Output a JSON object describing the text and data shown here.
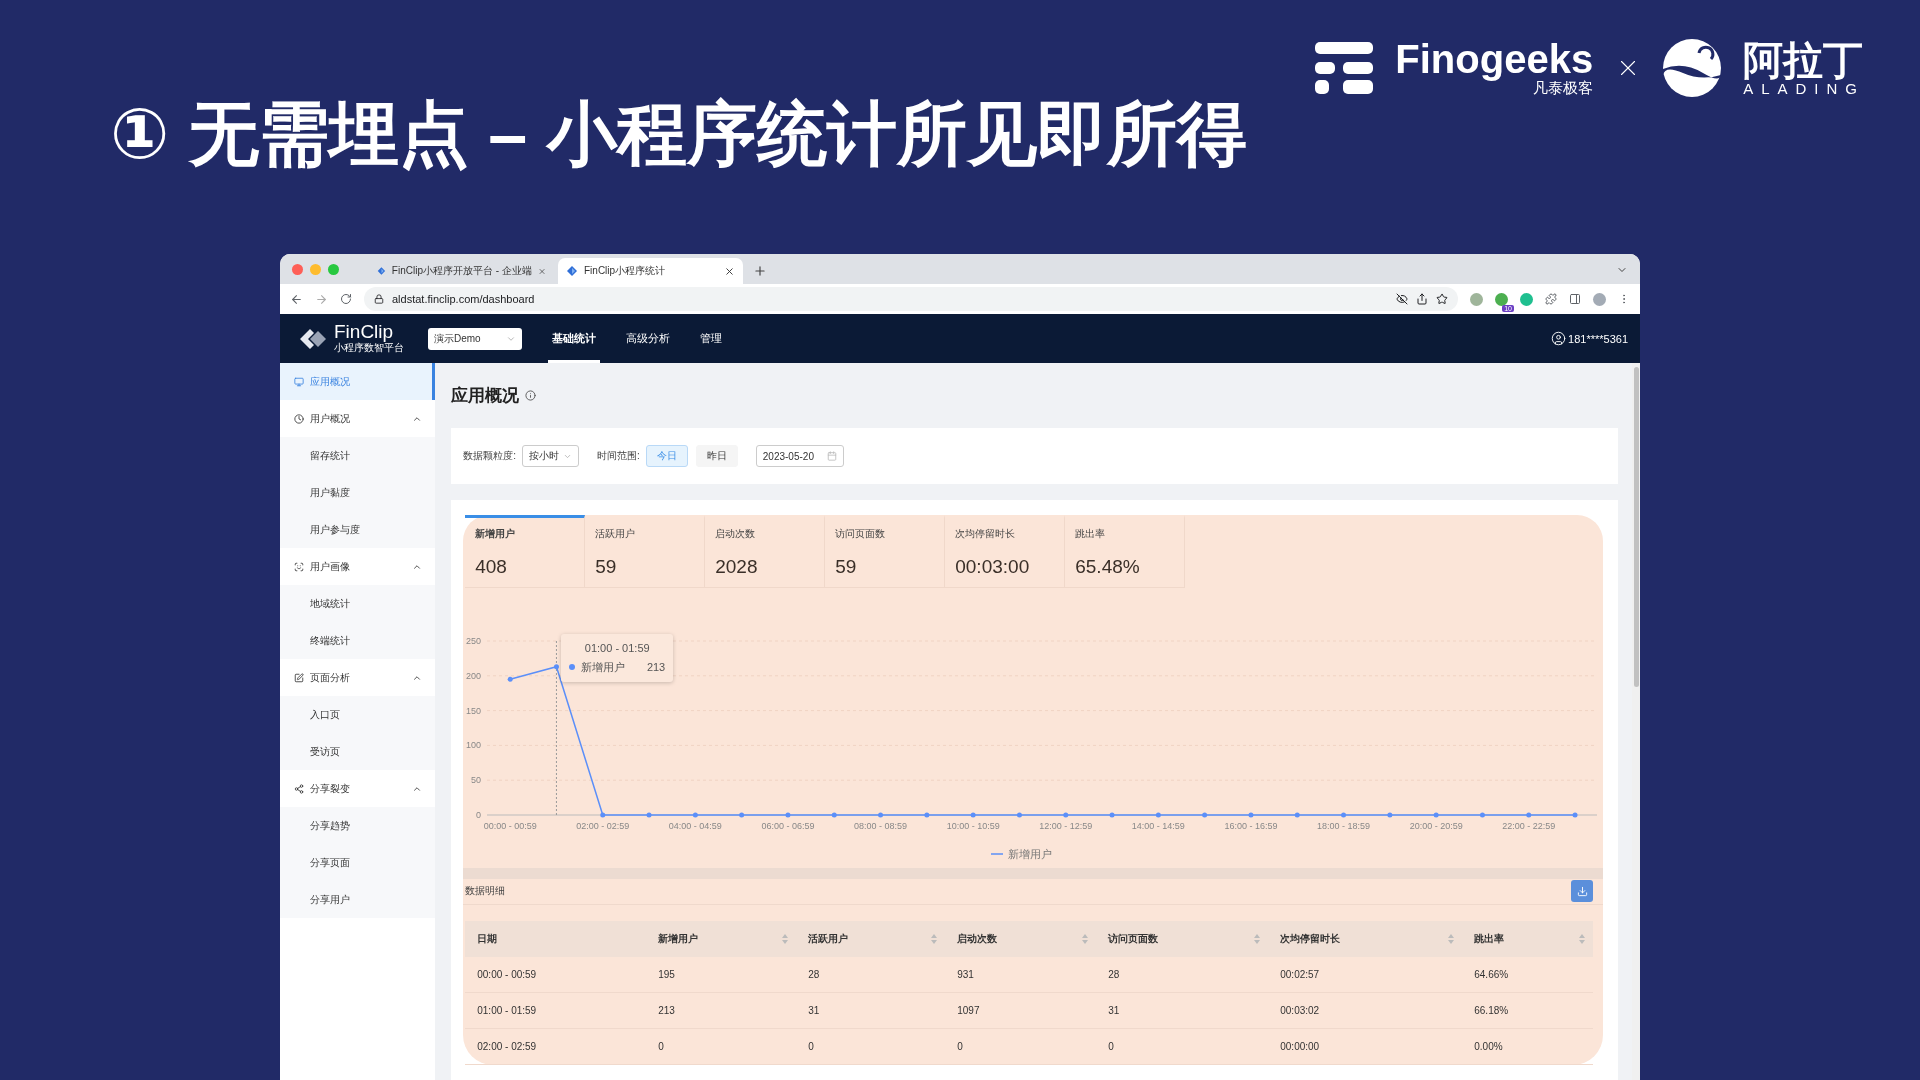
{
  "slide": {
    "title": "① 无需埋点 – 小程序统计所见即所得",
    "brand_a": "Finogeeks",
    "brand_a_sub": "凡泰极客",
    "brand_b": "阿拉丁",
    "brand_b_sub": "ALADING"
  },
  "browser": {
    "tabs": [
      {
        "title": "FinClip小程序开放平台 - 企业端",
        "selected": false
      },
      {
        "title": "FinClip小程序统计",
        "selected": true
      }
    ],
    "url": "aldstat.finclip.com/dashboard",
    "extension_badge": "10"
  },
  "app": {
    "logo": "FinClip",
    "logo_subtitle": "小程序数智平台",
    "app_select": "演示Demo",
    "nav": [
      {
        "label": "基础统计",
        "selected": true
      },
      {
        "label": "高级分析",
        "selected": false
      },
      {
        "label": "管理",
        "selected": false
      }
    ],
    "user": "181****5361"
  },
  "sidebar": [
    {
      "label": "应用概况",
      "selected": true
    },
    {
      "label": "用户概况",
      "selected": false,
      "expanded": true,
      "children": [
        {
          "label": "留存统计",
          "selected": false
        },
        {
          "label": "用户黏度",
          "selected": false
        },
        {
          "label": "用户参与度",
          "selected": false
        }
      ]
    },
    {
      "label": "用户画像",
      "selected": false,
      "expanded": true,
      "children": [
        {
          "label": "地域统计",
          "selected": false
        },
        {
          "label": "终端统计",
          "selected": false
        }
      ]
    },
    {
      "label": "页面分析",
      "selected": false,
      "expanded": true,
      "children": [
        {
          "label": "入口页",
          "selected": false
        },
        {
          "label": "受访页",
          "selected": false
        }
      ]
    },
    {
      "label": "分享裂变",
      "selected": false,
      "expanded": true,
      "children": [
        {
          "label": "分享趋势",
          "selected": false
        },
        {
          "label": "分享页面",
          "selected": false
        },
        {
          "label": "分享用户",
          "selected": false
        }
      ]
    }
  ],
  "page": {
    "title": "应用概况"
  },
  "filters": {
    "granularity_label": "数据颗粒度:",
    "granularity": "按小时",
    "range_label": "时间范围:",
    "range_options": [
      {
        "label": "今日",
        "selected": true
      },
      {
        "label": "昨日",
        "selected": false
      }
    ],
    "date": "2023-05-20"
  },
  "metrics": [
    {
      "label": "新增用户",
      "value": "408",
      "selected": true
    },
    {
      "label": "活跃用户",
      "value": "59",
      "selected": false
    },
    {
      "label": "启动次数",
      "value": "2028",
      "selected": false
    },
    {
      "label": "访问页面数",
      "value": "59",
      "selected": false
    },
    {
      "label": "次均停留时长",
      "value": "00:03:00",
      "selected": false
    },
    {
      "label": "跳出率",
      "value": "65.48%",
      "selected": false
    }
  ],
  "chart": {
    "chart_data": {
      "type": "line",
      "categories": [
        "00:00 - 00:59",
        null,
        "02:00 - 02:59",
        null,
        "04:00 - 04:59",
        null,
        "06:00 - 06:59",
        null,
        "08:00 - 08:59",
        null,
        "10:00 - 10:59",
        null,
        "12:00 - 12:59",
        null,
        "14:00 - 14:59",
        null,
        "16:00 - 16:59",
        null,
        "18:00 - 18:59",
        null,
        "20:00 - 20:59",
        null,
        "22:00 - 22:59",
        null
      ],
      "series": [
        {
          "name": "新增用户",
          "color": "#5b8ff9",
          "values": [
            195,
            213,
            0,
            0,
            0,
            0,
            0,
            0,
            0,
            0,
            0,
            0,
            0,
            0,
            0,
            0,
            0,
            0,
            0,
            0,
            0,
            0,
            0,
            0
          ]
        }
      ],
      "ylim": [
        0,
        250
      ],
      "yticks": [
        0,
        50,
        100,
        150,
        200,
        250
      ],
      "grid": true
    },
    "tooltip": {
      "title": "01:00 - 01:59",
      "series": "新增用户",
      "value": "213"
    }
  },
  "detail": {
    "title": "数据明细",
    "columns": [
      "日期",
      "新增用户",
      "活跃用户",
      "启动次数",
      "访问页面数",
      "次均停留时长",
      "跳出率"
    ],
    "rows": [
      [
        "00:00 - 00:59",
        "195",
        "28",
        "931",
        "28",
        "00:02:57",
        "64.66%"
      ],
      [
        "01:00 - 01:59",
        "213",
        "31",
        "1097",
        "31",
        "00:03:02",
        "66.18%"
      ],
      [
        "02:00 - 02:59",
        "0",
        "0",
        "0",
        "0",
        "00:00:00",
        "0.00%"
      ]
    ]
  }
}
